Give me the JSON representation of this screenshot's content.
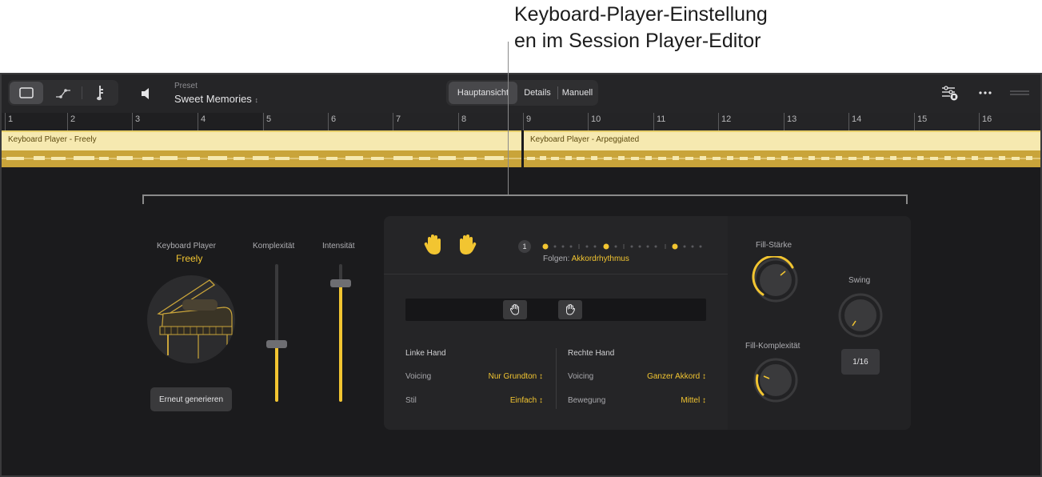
{
  "callout": {
    "line1": "Keyboard-Player-Einstellung",
    "line2": "en im Session Player-Editor"
  },
  "toolbar": {
    "preset_label": "Preset",
    "preset_value": "Sweet Memories",
    "views": [
      "Hauptansicht",
      "Details",
      "Manuell"
    ],
    "active_view": "Hauptansicht"
  },
  "ruler": {
    "bars": [
      "1",
      "2",
      "3",
      "4",
      "5",
      "6",
      "7",
      "8",
      "9",
      "10",
      "11",
      "12",
      "13",
      "14",
      "15",
      "16"
    ]
  },
  "regions": [
    {
      "name": "Keyboard Player - Freely"
    },
    {
      "name": "Keyboard Player - Arpeggiated"
    }
  ],
  "player": {
    "label": "Keyboard Player",
    "style": "Freely",
    "regenerate": "Erneut generieren"
  },
  "sliders": {
    "complexity_label": "Komplexität",
    "complexity_value": 0.42,
    "intensity_label": "Intensität",
    "intensity_value": 0.86
  },
  "editor": {
    "badge": "1",
    "follow_label": "Folgen:",
    "follow_value": "Akkordrhythmus",
    "left_hand": {
      "title": "Linke Hand",
      "voicing_label": "Voicing",
      "voicing_value": "Nur Grundton",
      "style_label": "Stil",
      "style_value": "Einfach"
    },
    "right_hand": {
      "title": "Rechte Hand",
      "voicing_label": "Voicing",
      "voicing_value": "Ganzer Akkord",
      "movement_label": "Bewegung",
      "movement_value": "Mittel"
    }
  },
  "knobs": {
    "fill_strength_label": "Fill-Stärke",
    "fill_complexity_label": "Fill-Komplexität",
    "swing_label": "Swing",
    "swing_rate": "1/16"
  },
  "colors": {
    "accent": "#f2c531",
    "background": "#1b1b1d",
    "region_top": "#f6e9b0",
    "region_bottom": "#c9a43a"
  }
}
